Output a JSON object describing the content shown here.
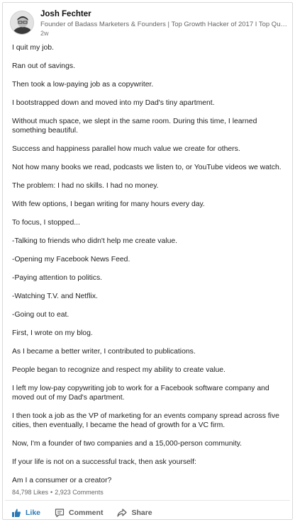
{
  "post": {
    "author": {
      "name": "Josh Fechter",
      "headline": "Founder of Badass Marketers & Founders | Top Growth Hacker of 2017 I Top Quor...",
      "time": "2w"
    },
    "paragraphs": [
      "I quit my job.",
      "Ran out of savings.",
      "Then took a low-paying job as a copywriter.",
      "I bootstrapped down and moved into my Dad's tiny apartment.",
      "Without much space, we slept in the same room. During this time, I learned something beautiful.",
      "Success and happiness parallel how much value we create for others.",
      "Not how many books we read, podcasts we listen to, or YouTube videos we watch.",
      "The problem: I had no skills. I had no money.",
      "With few options, I began writing for many hours every day.",
      "To focus, I stopped...",
      "-Talking to friends who didn't help me create value.",
      "-Opening my Facebook News Feed.",
      "-Paying attention to politics.",
      "-Watching T.V. and Netflix.",
      "-Going out to eat.",
      "First, I wrote on my blog.",
      "As I became a better writer, I contributed to publications.",
      "People began to recognize and respect my ability to create value.",
      "I left my low-pay copywriting job to work for a Facebook software company and moved out of my Dad's apartment.",
      "I then took a job as the VP of marketing for an events company spread across five cities, then eventually, I became the head of growth for a VC firm.",
      "Now, I'm a founder of two companies and a 15,000-person community.",
      "If your life is not on a successful track, then ask yourself:",
      "Am I a consumer or a creator?"
    ],
    "stats": {
      "likes": "84,798 Likes",
      "separator": "•",
      "comments": "2,923 Comments"
    },
    "actions": {
      "like": "Like",
      "comment": "Comment",
      "share": "Share"
    },
    "icons": {
      "like": "thumbs-up-icon",
      "comment": "comment-icon",
      "share": "share-arrow-icon"
    },
    "colors": {
      "like_accent": "#2a7ab8",
      "muted_text": "#5e5e5e"
    }
  }
}
